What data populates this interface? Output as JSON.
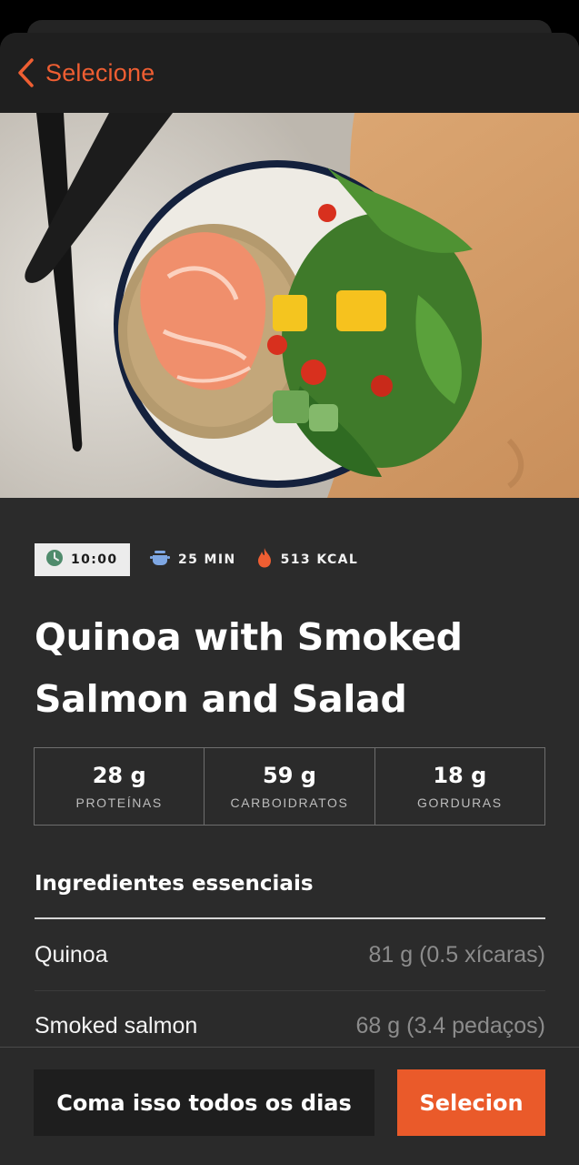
{
  "header": {
    "back_label": "Selecione",
    "back_icon": "chevron-left-icon",
    "accent_color": "#ef5e32"
  },
  "hero": {
    "image_description_icon": "food-photo"
  },
  "meta": {
    "time": "10:00",
    "time_icon": "clock-icon",
    "duration": "25 MIN",
    "duration_icon": "pot-icon",
    "calories": "513 KCAL",
    "calories_icon": "flame-icon"
  },
  "recipe": {
    "title": "Quinoa with Smoked Salmon and Salad"
  },
  "macros": [
    {
      "value": "28 g",
      "label": "PROTEÍNAS"
    },
    {
      "value": "59 g",
      "label": "CARBOIDRATOS"
    },
    {
      "value": "18 g",
      "label": "GORDURAS"
    }
  ],
  "ingredients": {
    "title": "Ingredientes essenciais",
    "items": [
      {
        "name": "Quinoa",
        "amount": "81 g (0.5 xícaras)"
      },
      {
        "name": "Smoked salmon",
        "amount": "68 g (3.4 pedaços)"
      }
    ]
  },
  "footer": {
    "daily_label": "Coma isso todos os dias",
    "select_label": "Selecion",
    "select_color": "#ea5a2a"
  }
}
